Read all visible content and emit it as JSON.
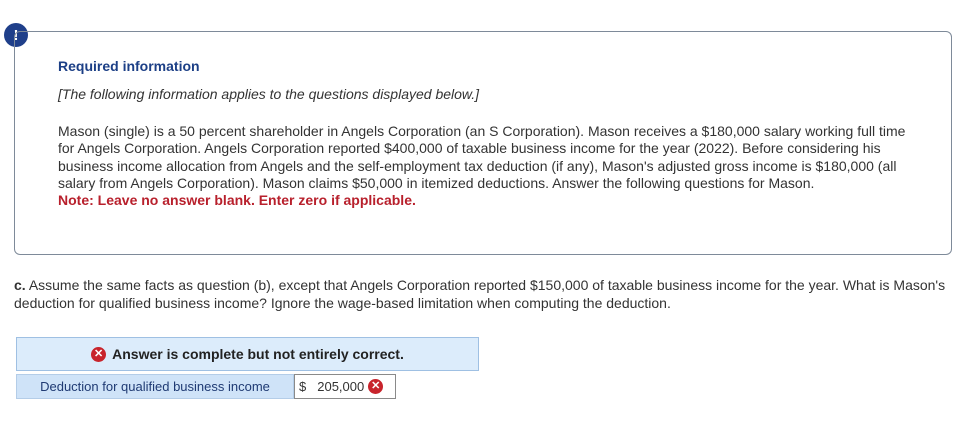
{
  "alert_badge": "!",
  "info": {
    "title": "Required information",
    "subtitle": "[The following information applies to the questions displayed below.]",
    "body": "Mason (single) is a 50 percent shareholder in Angels Corporation (an S Corporation). Mason receives a $180,000 salary working full time for Angels Corporation. Angels Corporation reported $400,000 of taxable business income for the year (2022). Before considering his business income allocation from Angels and the self-employment tax deduction (if any), Mason's adjusted gross income is $180,000 (all salary from Angels Corporation). Mason claims $50,000 in itemized deductions. Answer the following questions for Mason.",
    "note": "Note: Leave no answer blank. Enter zero if applicable."
  },
  "question": {
    "label": "c.",
    "text": "Assume the same facts as question (b), except that Angels Corporation reported $150,000 of taxable business income for the year. What is Mason's deduction for qualified business income? Ignore the wage-based limitation when computing the deduction."
  },
  "answer": {
    "status": "Answer is complete but not entirely correct.",
    "row_label": "Deduction for qualified business income",
    "currency": "$",
    "value": "205,000",
    "status_color": "#c8242c"
  }
}
